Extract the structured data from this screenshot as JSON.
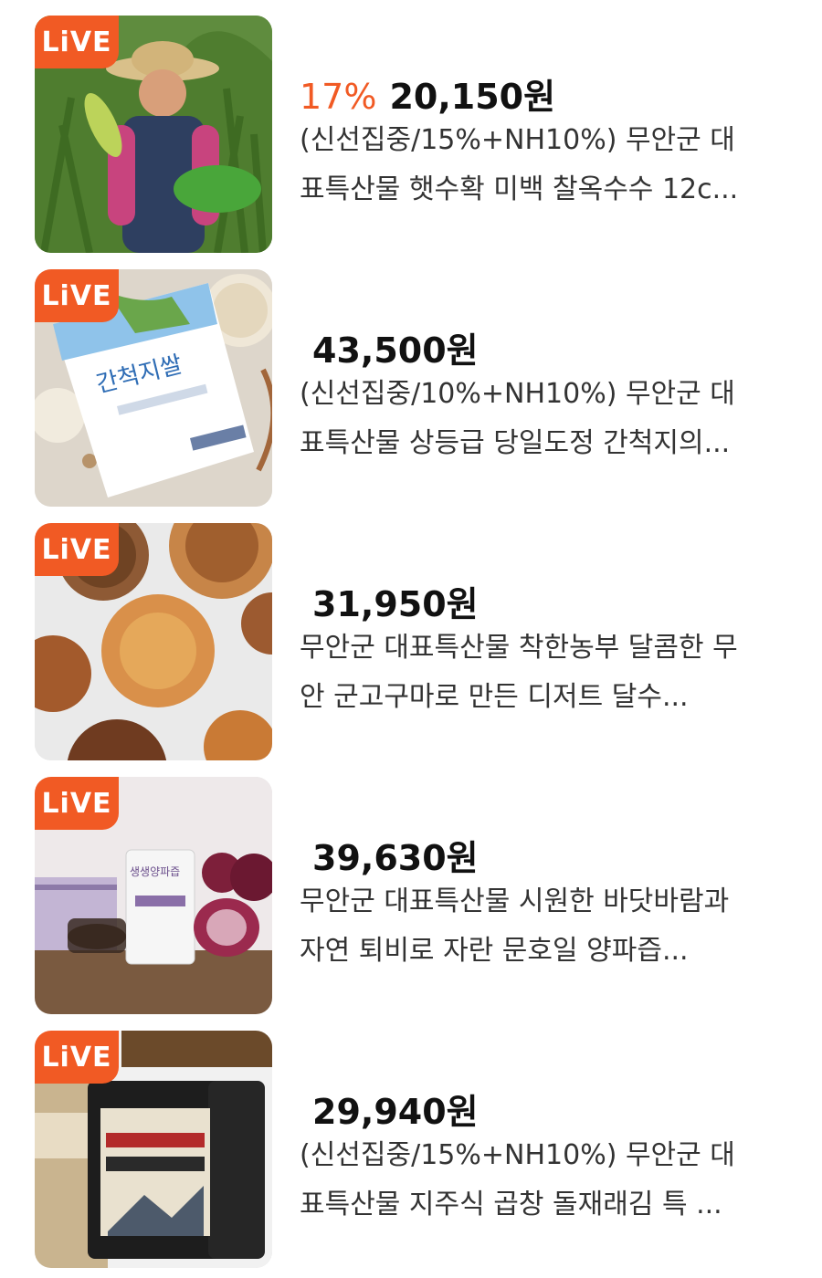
{
  "products": [
    {
      "live_badge": "LiVE",
      "discount": "17%",
      "price": "20,150원",
      "title": "(신선집중/15%+NH10%) 무안군 대표특산물 햇수확 미백 찰옥수수 12c..."
    },
    {
      "live_badge": "LiVE",
      "discount": "",
      "price": "43,500원",
      "title": "(신선집중/10%+NH10%) 무안군 대표특산물 상등급 당일도정 간척지의..."
    },
    {
      "live_badge": "LiVE",
      "discount": "",
      "price": "31,950원",
      "title": "무안군 대표특산물 착한농부 달콤한 무안 군고구마로 만든 디저트 달수..."
    },
    {
      "live_badge": "LiVE",
      "discount": "",
      "price": "39,630원",
      "title": "무안군 대표특산물 시원한 바닷바람과 자연 퇴비로 자란 문호일 양파즙..."
    },
    {
      "live_badge": "LiVE",
      "discount": "",
      "price": "29,940원",
      "title": "(신선집중/15%+NH10%) 무안군 대표특산물 지주식 곱창 돌재래김 특 ..."
    }
  ],
  "accent_color": "#f15a24"
}
